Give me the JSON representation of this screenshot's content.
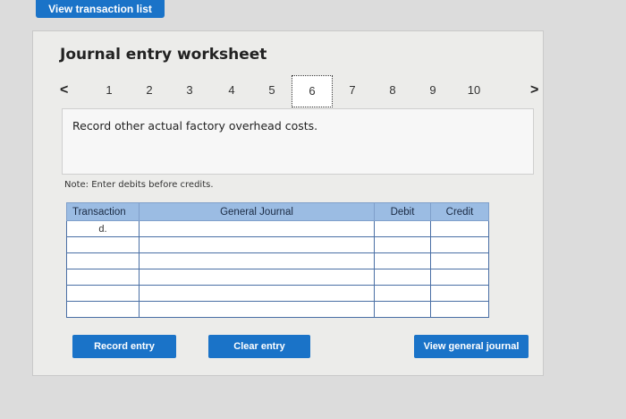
{
  "header": {
    "view_transactions_label": "View transaction list"
  },
  "worksheet": {
    "title": "Journal entry worksheet",
    "pages": [
      "1",
      "2",
      "3",
      "4",
      "5",
      "6",
      "7",
      "8",
      "9",
      "10"
    ],
    "active_page": "6",
    "prev_icon": "<",
    "next_icon": ">",
    "instruction": "Record other actual factory overhead costs.",
    "note": "Note: Enter debits before credits."
  },
  "journal_table": {
    "headers": [
      "Transaction",
      "General Journal",
      "Debit",
      "Credit"
    ],
    "rows": [
      {
        "transaction": "d.",
        "account": "",
        "debit": "",
        "credit": ""
      },
      {
        "transaction": "",
        "account": "",
        "debit": "",
        "credit": ""
      },
      {
        "transaction": "",
        "account": "",
        "debit": "",
        "credit": ""
      },
      {
        "transaction": "",
        "account": "",
        "debit": "",
        "credit": ""
      },
      {
        "transaction": "",
        "account": "",
        "debit": "",
        "credit": ""
      },
      {
        "transaction": "",
        "account": "",
        "debit": "",
        "credit": ""
      }
    ]
  },
  "actions": {
    "record_entry": "Record entry",
    "clear_entry": "Clear entry",
    "view_general_journal": "View general journal"
  },
  "colors": {
    "accent": "#1a73c8",
    "header_bg": "#9bbce3",
    "panel_bg": "#ececea"
  }
}
